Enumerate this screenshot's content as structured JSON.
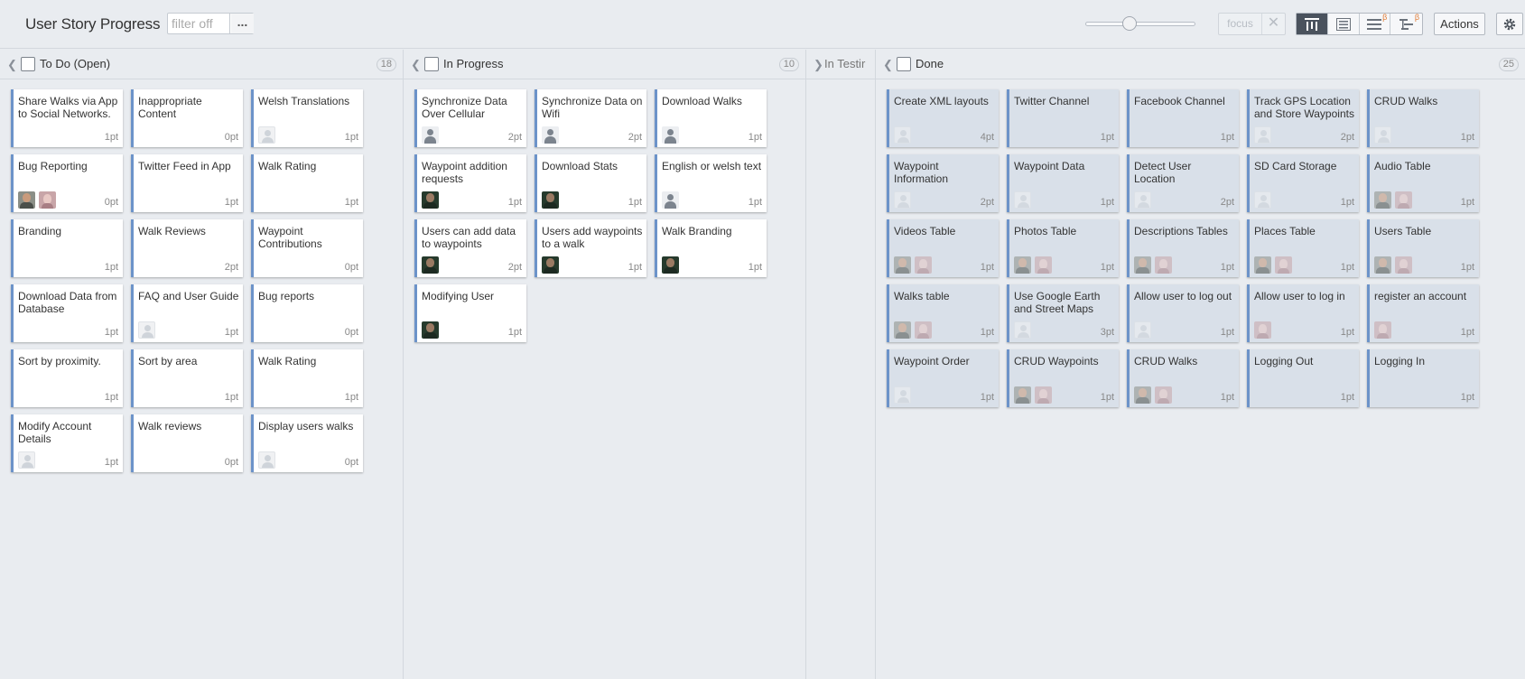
{
  "header": {
    "title": "User Story Progress",
    "filter_placeholder": "filter off",
    "filter_more": "...",
    "zoom_level": 0.4,
    "focus_label": "focus",
    "focus_clear": "✕",
    "beta_mark": "β",
    "actions_label": "Actions"
  },
  "columns": {
    "todo": {
      "title": "To Do (Open)",
      "count": "18",
      "cards": [
        {
          "title": "Share Walks via App to Social Networks.",
          "points": "1pt",
          "avatars": []
        },
        {
          "title": "Inappropriate Content",
          "points": "0pt",
          "avatars": []
        },
        {
          "title": "Welsh Translations",
          "points": "1pt",
          "avatars": [
            "blank"
          ]
        },
        {
          "title": "Bug Reporting",
          "points": "0pt",
          "avatars": [
            "photo-a",
            "photo-b"
          ]
        },
        {
          "title": "Twitter Feed in App",
          "points": "1pt",
          "avatars": []
        },
        {
          "title": "Walk Rating",
          "points": "1pt",
          "avatars": []
        },
        {
          "title": "Branding",
          "points": "1pt",
          "avatars": []
        },
        {
          "title": "Walk Reviews",
          "points": "2pt",
          "avatars": []
        },
        {
          "title": "Waypoint Contributions",
          "points": "0pt",
          "avatars": []
        },
        {
          "title": "Download Data from Database",
          "points": "1pt",
          "avatars": []
        },
        {
          "title": "FAQ and User Guide",
          "points": "1pt",
          "avatars": [
            "blank"
          ]
        },
        {
          "title": "Bug reports",
          "points": "0pt",
          "avatars": []
        },
        {
          "title": "Sort by proximity.",
          "points": "1pt",
          "avatars": []
        },
        {
          "title": "Sort by area",
          "points": "1pt",
          "avatars": []
        },
        {
          "title": "Walk Rating",
          "points": "1pt",
          "avatars": []
        },
        {
          "title": "Modify Account Details",
          "points": "1pt",
          "avatars": [
            "blank"
          ]
        },
        {
          "title": "Walk reviews",
          "points": "0pt",
          "avatars": []
        },
        {
          "title": "Display users walks",
          "points": "0pt",
          "avatars": [
            "blank"
          ]
        }
      ]
    },
    "inprogress": {
      "title": "In Progress",
      "count": "10",
      "cards": [
        {
          "title": "Synchronize Data Over Cellular",
          "points": "2pt",
          "avatars": [
            "default"
          ]
        },
        {
          "title": "Synchronize Data on Wifi",
          "points": "2pt",
          "avatars": [
            "default"
          ]
        },
        {
          "title": "Download Walks",
          "points": "1pt",
          "avatars": [
            "default"
          ]
        },
        {
          "title": "Waypoint addition requests",
          "points": "1pt",
          "avatars": [
            "photo-c"
          ]
        },
        {
          "title": "Download Stats",
          "points": "1pt",
          "avatars": [
            "photo-c"
          ]
        },
        {
          "title": "English or welsh text",
          "points": "1pt",
          "avatars": [
            "default"
          ]
        },
        {
          "title": "Users can add data to waypoints",
          "points": "2pt",
          "avatars": [
            "photo-c"
          ]
        },
        {
          "title": "Users add waypoints to a walk",
          "points": "1pt",
          "avatars": [
            "photo-c"
          ]
        },
        {
          "title": "Walk Branding",
          "points": "1pt",
          "avatars": [
            "photo-c"
          ]
        },
        {
          "title": "Modifying User",
          "points": "1pt",
          "avatars": [
            "photo-c"
          ]
        }
      ]
    },
    "intesting": {
      "title": "In Testir"
    },
    "done": {
      "title": "Done",
      "count": "25",
      "cards": [
        {
          "title": "Create XML layouts",
          "points": "4pt",
          "avatars": [
            "blank"
          ]
        },
        {
          "title": "Twitter Channel",
          "points": "1pt",
          "avatars": []
        },
        {
          "title": "Facebook Channel",
          "points": "1pt",
          "avatars": []
        },
        {
          "title": "Track GPS Location and Store Waypoints",
          "points": "2pt",
          "avatars": [
            "blank"
          ]
        },
        {
          "title": "CRUD Walks",
          "points": "1pt",
          "avatars": [
            "blank"
          ]
        },
        {
          "title": "Waypoint Information",
          "points": "2pt",
          "avatars": [
            "blank"
          ]
        },
        {
          "title": "Waypoint Data",
          "points": "1pt",
          "avatars": [
            "blank"
          ]
        },
        {
          "title": "Detect User Location",
          "points": "2pt",
          "avatars": [
            "blank"
          ]
        },
        {
          "title": "SD Card Storage",
          "points": "1pt",
          "avatars": [
            "blank"
          ]
        },
        {
          "title": "Audio Table",
          "points": "1pt",
          "avatars": [
            "photo-a",
            "photo-b"
          ]
        },
        {
          "title": "Videos Table",
          "points": "1pt",
          "avatars": [
            "photo-a",
            "photo-b"
          ]
        },
        {
          "title": "Photos Table",
          "points": "1pt",
          "avatars": [
            "photo-a",
            "photo-b"
          ]
        },
        {
          "title": "Descriptions Tables",
          "points": "1pt",
          "avatars": [
            "photo-a",
            "photo-b"
          ]
        },
        {
          "title": "Places Table",
          "points": "1pt",
          "avatars": [
            "photo-a",
            "photo-b"
          ]
        },
        {
          "title": "Users Table",
          "points": "1pt",
          "avatars": [
            "photo-a",
            "photo-b"
          ]
        },
        {
          "title": "Walks table",
          "points": "1pt",
          "avatars": [
            "photo-a",
            "photo-b"
          ]
        },
        {
          "title": "Use Google Earth and Street Maps",
          "points": "3pt",
          "avatars": [
            "blank"
          ]
        },
        {
          "title": "Allow user to log out",
          "points": "1pt",
          "avatars": [
            "blank"
          ]
        },
        {
          "title": "Allow user to log in",
          "points": "1pt",
          "avatars": [
            "photo-b"
          ]
        },
        {
          "title": "register an account",
          "points": "1pt",
          "avatars": [
            "photo-b"
          ]
        },
        {
          "title": "Waypoint Order",
          "points": "1pt",
          "avatars": [
            "blank"
          ]
        },
        {
          "title": "CRUD Waypoints",
          "points": "1pt",
          "avatars": [
            "photo-a",
            "photo-b"
          ]
        },
        {
          "title": "CRUD Walks",
          "points": "1pt",
          "avatars": [
            "photo-a",
            "photo-b"
          ]
        },
        {
          "title": "Logging Out",
          "points": "1pt",
          "avatars": []
        },
        {
          "title": "Logging In",
          "points": "1pt",
          "avatars": []
        }
      ]
    }
  },
  "colors": {
    "card_accent": "#6c93c9",
    "done_card_bg": "#d9e0e9",
    "active_view": "#4a525d",
    "beta": "#e07a32"
  }
}
